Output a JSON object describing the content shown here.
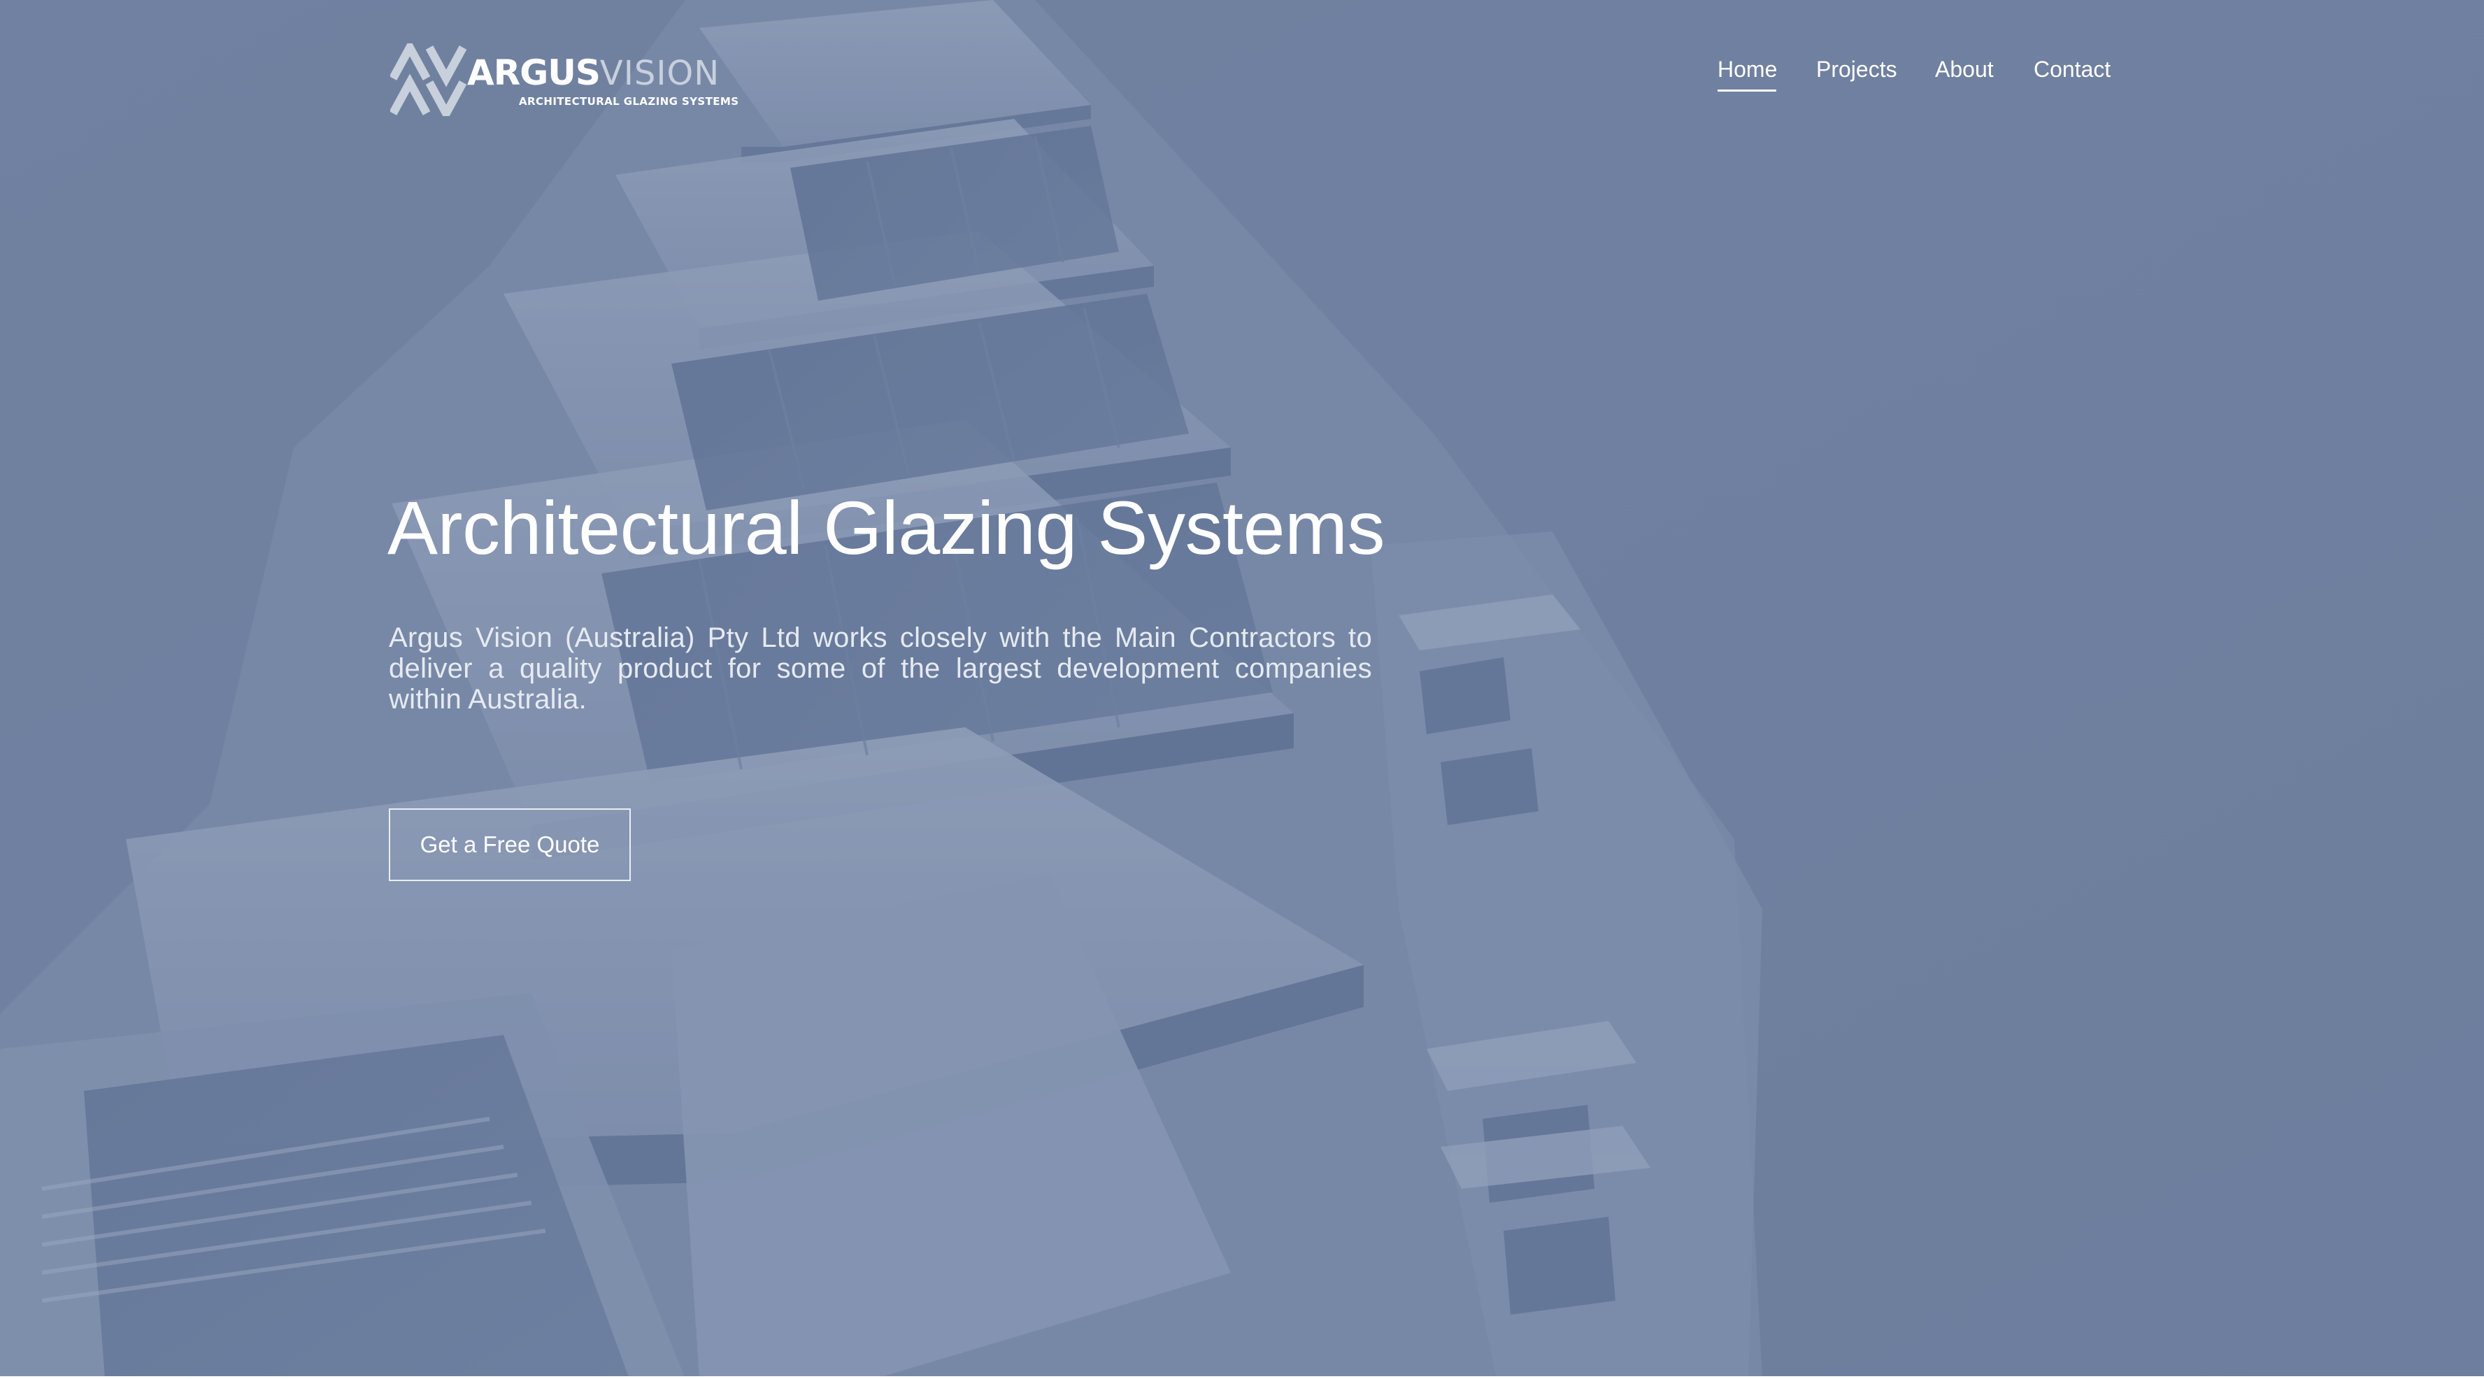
{
  "brand": {
    "name_bold": "ARGUS",
    "name_light": "VISION",
    "tagline": "ARCHITECTURAL GLAZING SYSTEMS"
  },
  "nav": {
    "items": [
      {
        "label": "Home",
        "active": true
      },
      {
        "label": "Projects",
        "active": false
      },
      {
        "label": "About",
        "active": false
      },
      {
        "label": "Contact",
        "active": false
      }
    ]
  },
  "hero": {
    "title": "Architectural Glazing Systems",
    "description": "Argus Vision (Australia) Pty Ltd works closely with the Main Contractors to deliver a quality product for some of the largest development companies within Australia.",
    "cta_label": "Get a Free Quote",
    "background_image": "building-facade-image"
  },
  "colors": {
    "overlay": "#6f80a0",
    "text": "#ffffff",
    "logo_mark": "#c8d0dc"
  }
}
